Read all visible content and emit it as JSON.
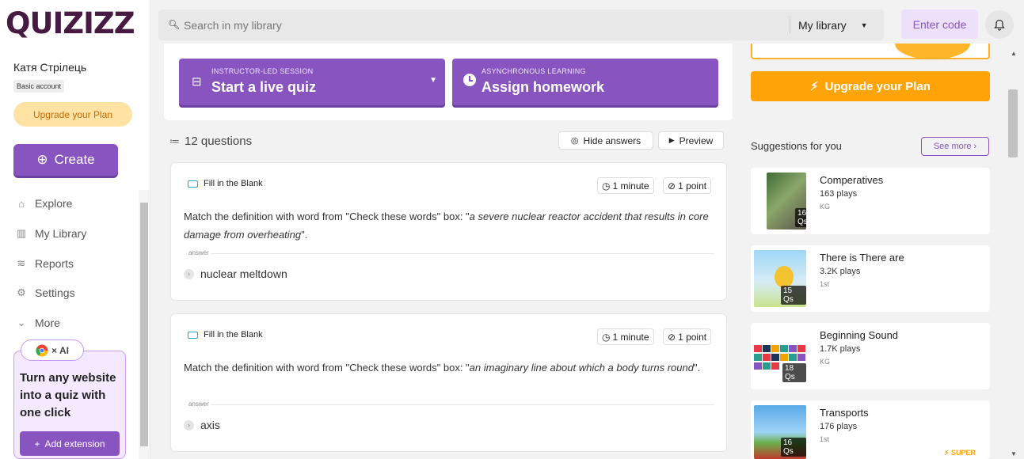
{
  "app": {
    "logo": "QUIZIZZ"
  },
  "sidebar": {
    "user_name": "Катя Стрілець",
    "account_type": "Basic account",
    "upgrade_label": "Upgrade your Plan",
    "create_label": "Create",
    "nav": [
      {
        "label": "Explore",
        "icon": "explore-icon"
      },
      {
        "label": "My Library",
        "icon": "library-icon"
      },
      {
        "label": "Reports",
        "icon": "reports-icon"
      },
      {
        "label": "Settings",
        "icon": "settings-icon"
      },
      {
        "label": "More",
        "icon": "chevron-down-icon"
      }
    ],
    "extension": {
      "pill_text": "× AI",
      "text": "Turn any website into a quiz with one click",
      "button_label": "Add extension"
    }
  },
  "header": {
    "search_placeholder": "Search in my library",
    "scope": "My library",
    "enter_code": "Enter code"
  },
  "actions": {
    "live": {
      "small": "INSTRUCTOR-LED SESSION",
      "big": "Start a live quiz"
    },
    "homework": {
      "small": "ASYNCHRONOUS LEARNING",
      "big": "Assign homework"
    }
  },
  "quiz": {
    "count_label": "12 questions",
    "hide_answers": "Hide answers",
    "preview": "Preview",
    "questions": [
      {
        "type": "Fill in the Blank",
        "time": "1 minute",
        "points": "1 point",
        "prefix": "Match the definition with word from \"Check these words\" box: \"",
        "definition": "a severe nuclear reactor accident that results in core damage from overheating",
        "suffix": "\".",
        "answer_label": "answer",
        "answer": "nuclear meltdown"
      },
      {
        "type": "Fill in the Blank",
        "time": "1 minute",
        "points": "1 point",
        "prefix": "Match the definition with word from \"Check these words\" box: \"",
        "definition": "an imaginary line about which a body turns round",
        "suffix": "\".",
        "answer_label": "answer",
        "answer": "axis"
      }
    ]
  },
  "right": {
    "upgrade_label": "Upgrade your Plan",
    "suggestions_title": "Suggestions for you",
    "see_more": "See more",
    "suggestions": [
      {
        "title": "Comperatives",
        "plays": "163 plays",
        "grade": "KG",
        "qs": "16 Qs",
        "badge": ""
      },
      {
        "title": "There is There are",
        "plays": "3.2K plays",
        "grade": "1st",
        "qs": "15 Qs",
        "badge": ""
      },
      {
        "title": "Beginning Sound",
        "plays": "1.7K plays",
        "grade": "KG",
        "qs": "18 Qs",
        "badge": ""
      },
      {
        "title": "Transports",
        "plays": "176 plays",
        "grade": "1st",
        "qs": "16 Qs",
        "badge": "SUPER"
      }
    ]
  }
}
